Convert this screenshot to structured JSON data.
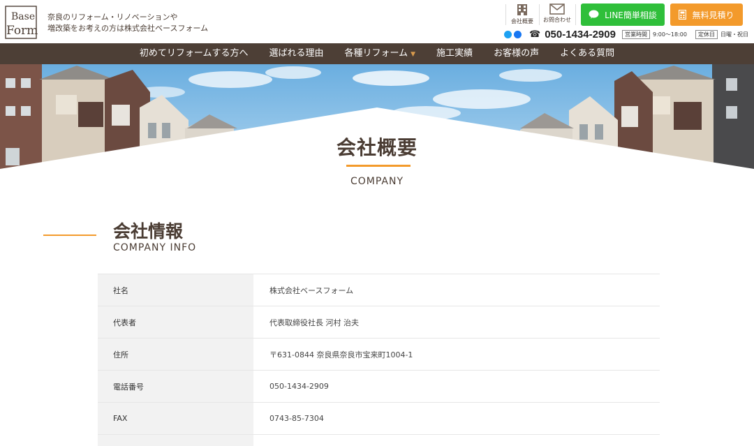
{
  "header": {
    "tagline_line1": "奈良のリフォーム・リノベーションや",
    "tagline_line2": "増改築をお考えの方は株式会社ベースフォーム",
    "company_label": "会社概要",
    "contact_label": "お問合わせ",
    "line_button": "LINE簡単相談",
    "estimate_button": "無料見積り",
    "phone": "050-1434-2909",
    "hours_tag": "営業時間",
    "hours": "9:00～18:00",
    "holiday_tag": "定休日",
    "holiday": "日曜・祝日",
    "colors": {
      "line": "#2fbf3a",
      "estimate": "#f39a2b",
      "nav": "#4d3f36",
      "accent": "#f39a2b"
    }
  },
  "nav": {
    "items": [
      "初めてリフォームする方へ",
      "選ばれる理由",
      "各種リフォーム",
      "施工実績",
      "お客様の声",
      "よくある質問"
    ]
  },
  "hero": {
    "title": "会社概要",
    "subtitle": "COMPANY"
  },
  "section": {
    "title": "会社情報",
    "subtitle": "COMPANY INFO"
  },
  "table": {
    "rows": [
      {
        "label": "社名",
        "value": "株式会社ベースフォーム"
      },
      {
        "label": "代表者",
        "value": "代表取締役社長 河村 治夫"
      },
      {
        "label": "住所",
        "value": "〒631-0844 奈良県奈良市宝来町1004-1"
      },
      {
        "label": "電話番号",
        "value": "050-1434-2909"
      },
      {
        "label": "FAX",
        "value": "0743-85-7304"
      },
      {
        "label": "",
        "value": ""
      }
    ]
  }
}
